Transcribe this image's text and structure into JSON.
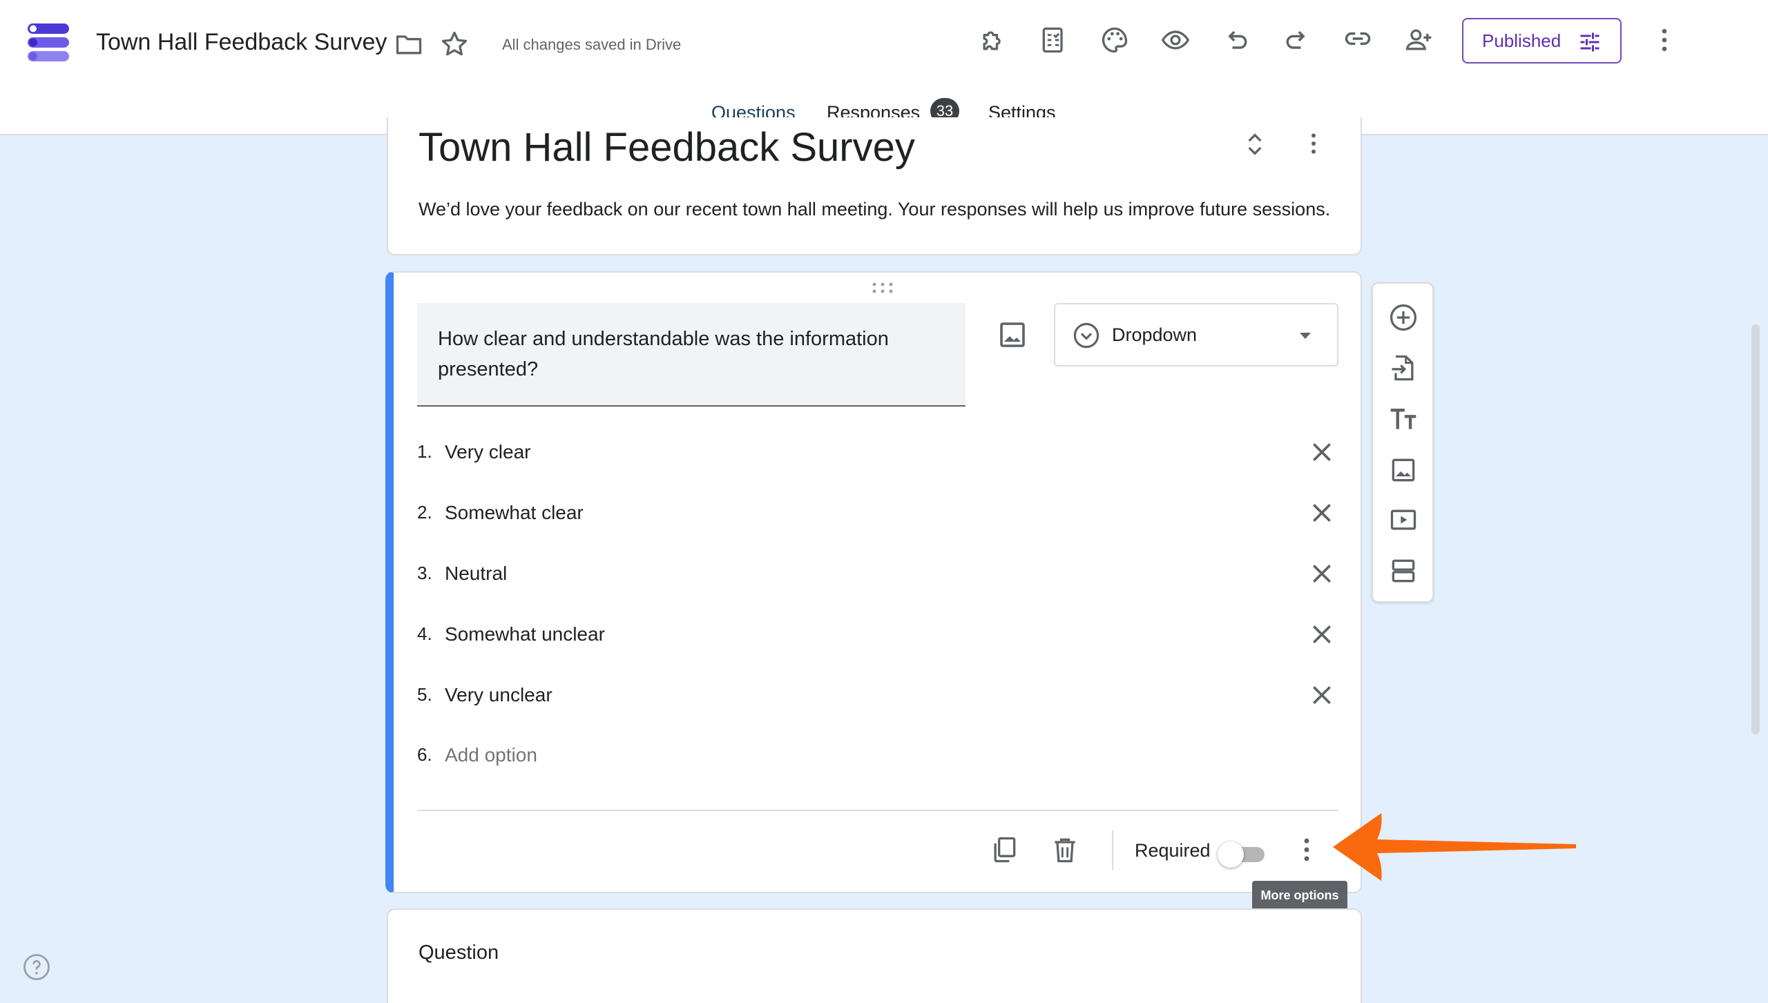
{
  "header": {
    "doc_title": "Town Hall Feedback Survey",
    "save_status": "All changes saved in Drive",
    "publish_label": "Published"
  },
  "tabs": [
    {
      "label": "Questions",
      "active": true
    },
    {
      "label": "Responses",
      "badge": "33"
    },
    {
      "label": "Settings"
    }
  ],
  "form": {
    "title": "Town Hall Feedback Survey",
    "description": "We’d love your feedback on our recent town hall meeting. Your responses will help us improve future sessions."
  },
  "question": {
    "text": "How clear and understandable was the information presented?",
    "type": "Dropdown",
    "options": [
      {
        "num": "1.",
        "label": "Very clear"
      },
      {
        "num": "2.",
        "label": "Somewhat clear"
      },
      {
        "num": "3.",
        "label": "Neutral"
      },
      {
        "num": "4.",
        "label": "Somewhat unclear"
      },
      {
        "num": "5.",
        "label": "Very unclear"
      }
    ],
    "add_option": {
      "num": "6.",
      "label": "Add option"
    },
    "required_label": "Required",
    "required": false,
    "tooltip": "More options"
  },
  "next_question": {
    "label": "Question"
  },
  "colors": {
    "accent": "#4285f4",
    "brand_purple": "#5f2fb4",
    "background": "#e3effc",
    "arrow": "#f96a0e"
  },
  "icons": {
    "header": [
      "addon-icon",
      "quiz-icon",
      "palette-icon",
      "preview-icon",
      "undo-icon",
      "redo-icon",
      "link-icon",
      "add-collaborator-icon",
      "more-vert-icon"
    ],
    "toolbar": [
      "add-question-icon",
      "import-questions-icon",
      "add-title-icon",
      "add-image-icon",
      "add-video-icon",
      "add-section-icon"
    ]
  }
}
